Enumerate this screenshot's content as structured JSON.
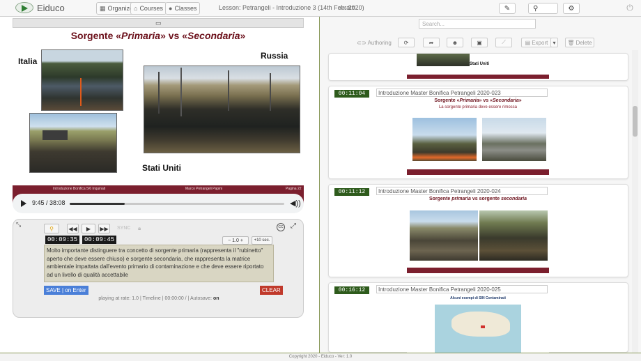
{
  "app": {
    "logo_text": "Eiduco",
    "nav": [
      {
        "label": "Organizer",
        "icon": "calendar-icon"
      },
      {
        "label": "Courses",
        "icon": "graduation-cap-icon"
      },
      {
        "label": "Classes",
        "icon": "microphone-icon"
      }
    ],
    "lesson_title": "Lesson: Petrangeli - Introduzione 3 (14th Feb. 2020)",
    "rate_label": "rate",
    "footer": "Copyright 2020 - Eiduco - Ver: 1.0"
  },
  "slide": {
    "title_pre": "Sorgente «",
    "title_em1": "Primaria",
    "title_mid": "» vs «",
    "title_em2": "Secondaria",
    "title_post": "»",
    "label_italia": "Italia",
    "label_russia": "Russia",
    "label_usa": "Stati Uniti",
    "footer_left": "Introduzione Bonifica 5/6 Inquinati",
    "footer_center": "Marco Petrangeli Papini",
    "footer_right": "Pagina 22"
  },
  "player": {
    "time": "9:45 / 38:08",
    "progress": 0.256
  },
  "transcript": {
    "sync_label": "SYNC",
    "rate_value": "1.0",
    "skip_label": "+10 sec.",
    "cc_label": "CC",
    "tc_start": "00:09:35",
    "tc_end": "00:09:45",
    "note": "Molto importante distinguere tra concetto di sorgente primaria (rappresenta il \"rubinetto\" aperto che deve essere chiuso) e sorgente secondaria, che rappresenta la matrice ambientale impattata dall'evento primario di contaminazione e che deve essere riportato ad un livello di qualità accettabile",
    "save_label": "SAVE | on Enter",
    "clear_label": "CLEAR",
    "status_pre": "playing at rate: 1.0  | Timeline | 00:00:00 / | Autosave: ",
    "status_autosave": "on"
  },
  "right": {
    "search_placeholder": "Search...",
    "authoring_label": "Authoring",
    "export_label": "Export",
    "delete_label": "Delete",
    "partial_card_caption": "Stati Uniti",
    "cards": [
      {
        "time": "00:11:04",
        "title": "Introduzione Master Bonifica Petrangeli 2020-023",
        "slide_title_pre": "Sorgente «",
        "slide_title_em1": "Primaria",
        "slide_title_mid": "» vs «",
        "slide_title_em2": "Secondaria",
        "slide_title_post": "»",
        "slide_sub": "La sorgente primaria deve essere rimossa"
      },
      {
        "time": "00:11:12",
        "title": "Introduzione Master Bonifica Petrangeli 2020-024",
        "slide_title_pre": "Sorgente ",
        "slide_title_em1": "primaria",
        "slide_title_mid": " vs sorgente ",
        "slide_title_em2": "secondaria"
      },
      {
        "time": "00:16:12",
        "title": "Introduzione Master Bonifica Petrangeli 2020-025",
        "slide_title": "Alcuni esempi di SIN Contaminati"
      }
    ]
  }
}
